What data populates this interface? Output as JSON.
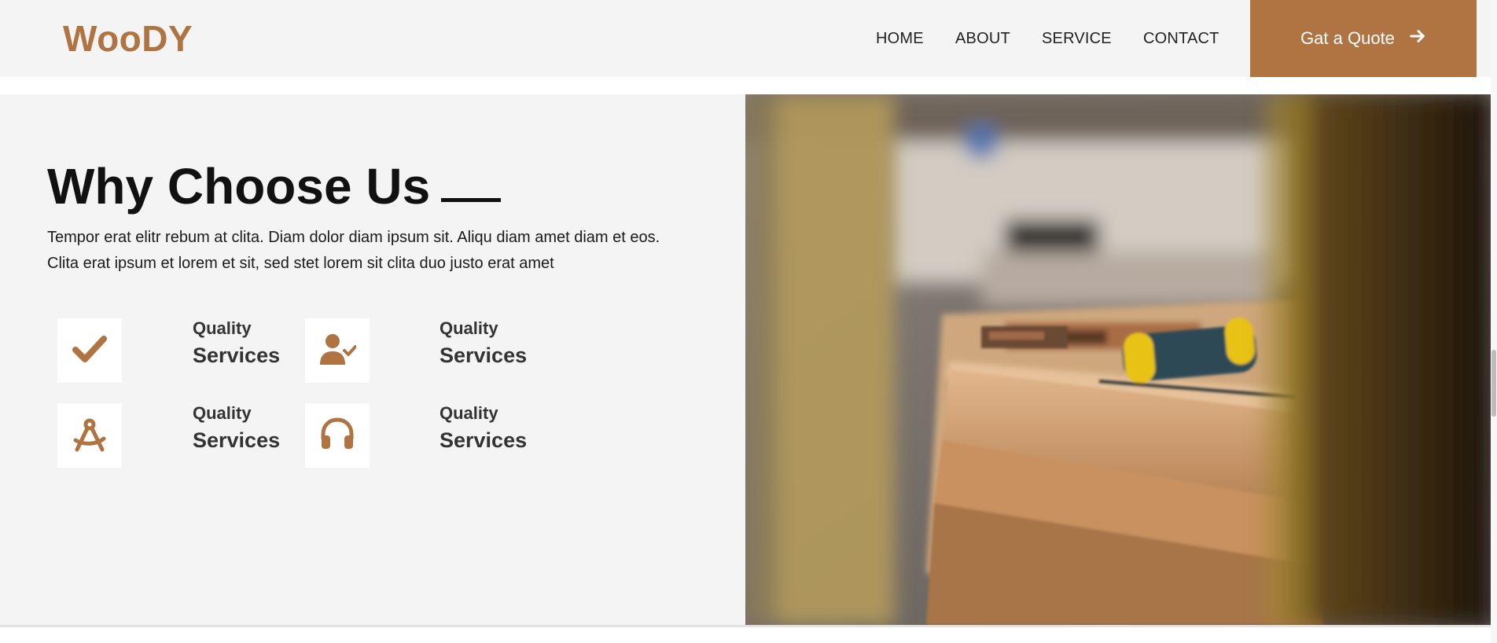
{
  "navbar": {
    "brand": "WooDY",
    "links": [
      "HOME",
      "ABOUT",
      "SERVICE",
      "CONTACT"
    ],
    "cta_label": "Gat a Quote",
    "cta_icon": "arrow-right-icon"
  },
  "section": {
    "title": "Why Choose Us",
    "description": "Tempor erat elitr rebum at clita. Diam dolor diam ipsum sit. Aliqu diam amet diam et eos. Clita erat ipsum et lorem et sit, sed stet lorem sit clita duo justo erat amet",
    "features": [
      {
        "icon": "check-icon",
        "line1": "Quality",
        "line2": "Services"
      },
      {
        "icon": "user-check-icon",
        "line1": "Quality",
        "line2": "Services"
      },
      {
        "icon": "drafting-compass-icon",
        "line1": "Quality",
        "line2": "Services"
      },
      {
        "icon": "headphones-icon",
        "line1": "Quality",
        "line2": "Services"
      }
    ]
  },
  "image": {
    "subject": "woodworking-workshop-photo"
  },
  "colors": {
    "accent": "#b07443",
    "section_bg": "#f4f4f4",
    "text": "#222222"
  }
}
